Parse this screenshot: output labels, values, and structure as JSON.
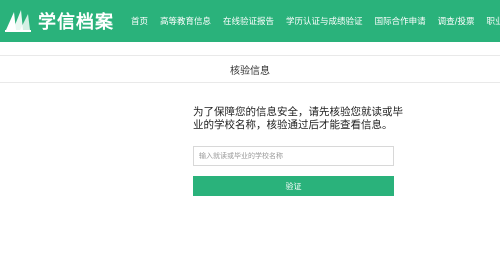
{
  "header": {
    "logo_text": "学信档案",
    "logo_icon": "book-pages-icon",
    "brand_color": "#2ab27b",
    "nav_items": [
      "首页",
      "高等教育信息",
      "在线验证报告",
      "学历认证与成绩验证",
      "国际合作申请",
      "调查/投票",
      "职业测评"
    ]
  },
  "page": {
    "title": "核验信息"
  },
  "form": {
    "notice": "为了保障您的信息安全，请先核验您就读或毕业的学校名称，核验通过后才能查看信息。",
    "school_placeholder": "输入就读或毕业的学校名称",
    "school_value": "",
    "submit_label": "验证"
  }
}
